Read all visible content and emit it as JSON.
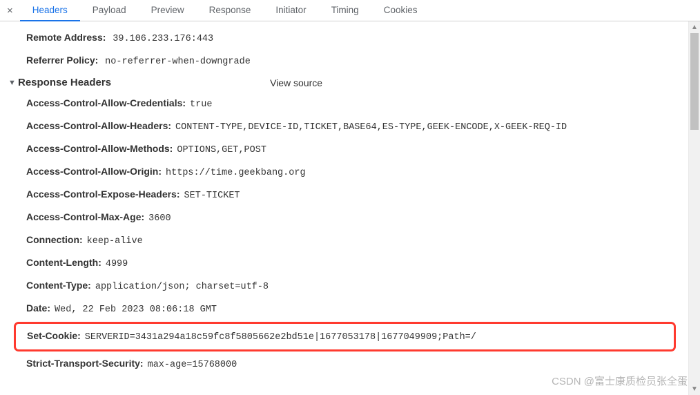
{
  "tabs": {
    "close": "×",
    "items": [
      "Headers",
      "Payload",
      "Preview",
      "Response",
      "Initiator",
      "Timing",
      "Cookies"
    ],
    "active_index": 0
  },
  "general": {
    "remote_address": {
      "key": "Remote Address:",
      "value": "39.106.233.176:443"
    },
    "referrer_policy": {
      "key": "Referrer Policy:",
      "value": "no-referrer-when-downgrade"
    }
  },
  "section": {
    "caret": "▼",
    "title": "Response Headers",
    "view_source": "View source"
  },
  "response_headers": [
    {
      "key": "Access-Control-Allow-Credentials:",
      "value": "true"
    },
    {
      "key": "Access-Control-Allow-Headers:",
      "value": "CONTENT-TYPE,DEVICE-ID,TICKET,BASE64,ES-TYPE,GEEK-ENCODE,X-GEEK-REQ-ID"
    },
    {
      "key": "Access-Control-Allow-Methods:",
      "value": "OPTIONS,GET,POST"
    },
    {
      "key": "Access-Control-Allow-Origin:",
      "value": "https://time.geekbang.org"
    },
    {
      "key": "Access-Control-Expose-Headers:",
      "value": "SET-TICKET"
    },
    {
      "key": "Access-Control-Max-Age:",
      "value": "3600"
    },
    {
      "key": "Connection:",
      "value": "keep-alive"
    },
    {
      "key": "Content-Length:",
      "value": "4999"
    },
    {
      "key": "Content-Type:",
      "value": "application/json; charset=utf-8"
    },
    {
      "key": "Date:",
      "value": "Wed, 22 Feb 2023 08:06:18 GMT"
    },
    {
      "key": "Set-Cookie:",
      "value": "SERVERID=3431a294a18c59fc8f5805662e2bd51e|1677053178|1677049909;Path=/",
      "highlight": true
    },
    {
      "key": "Strict-Transport-Security:",
      "value": "max-age=15768000"
    }
  ],
  "watermark": "CSDN @富士康质检员张全蛋"
}
